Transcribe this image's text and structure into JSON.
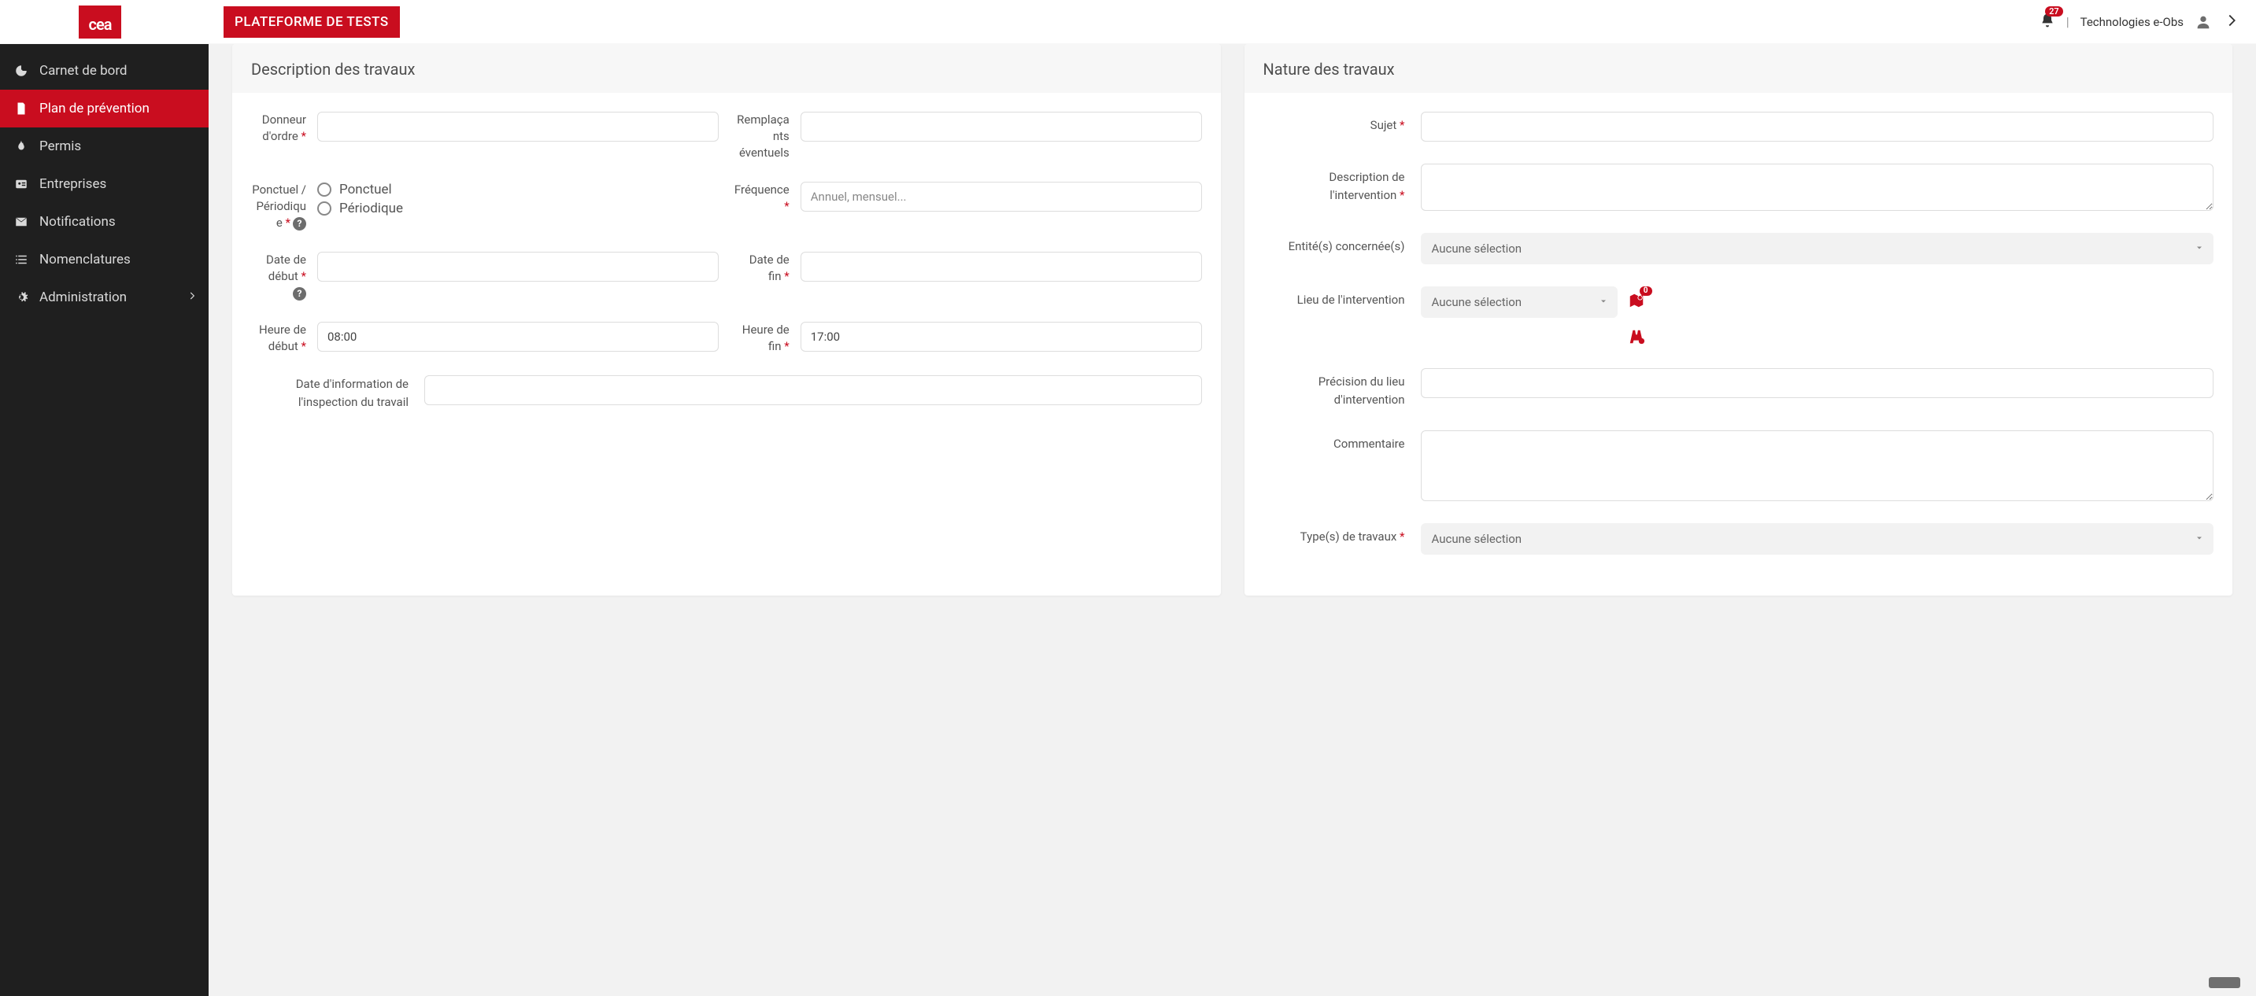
{
  "topbar": {
    "logo": "cea",
    "banner": "PLATEFORME DE TESTS",
    "notif_count": "27",
    "username": "Technologies e-Obs"
  },
  "sidebar": {
    "items": [
      {
        "label": "Carnet de bord"
      },
      {
        "label": "Plan de prévention"
      },
      {
        "label": "Permis"
      },
      {
        "label": "Entreprises"
      },
      {
        "label": "Notifications"
      },
      {
        "label": "Nomenclatures"
      },
      {
        "label": "Administration"
      }
    ]
  },
  "cards": {
    "left_title": "Description des travaux",
    "right_title": "Nature des travaux"
  },
  "desc": {
    "donneur_label": "Donneur d'ordre",
    "remplacants_label": "Remplaçants éventuels",
    "ponct_label": "Ponctuel / Périodique",
    "radio_ponctuel": "Ponctuel",
    "radio_periodique": "Périodique",
    "freq_label": "Fréquence",
    "freq_placeholder": "Annuel, mensuel...",
    "date_debut_label": "Date de début",
    "date_fin_label": "Date de fin",
    "heure_debut_label": "Heure de début",
    "heure_debut_value": "08:00",
    "heure_fin_label": "Heure de fin",
    "heure_fin_value": "17:00",
    "date_info_label": "Date d'information de l'inspection du travail"
  },
  "nat": {
    "sujet_label": "Sujet",
    "desc_interv_label": "Description de l'intervention",
    "entites_label": "Entité(s) concernée(s)",
    "lieu_label": "Lieu de l'intervention",
    "precision_label": "Précision du lieu d'intervention",
    "commentaire_label": "Commentaire",
    "types_label": "Type(s) de travaux",
    "map_badge": "0",
    "no_selection": "Aucune sélection"
  }
}
